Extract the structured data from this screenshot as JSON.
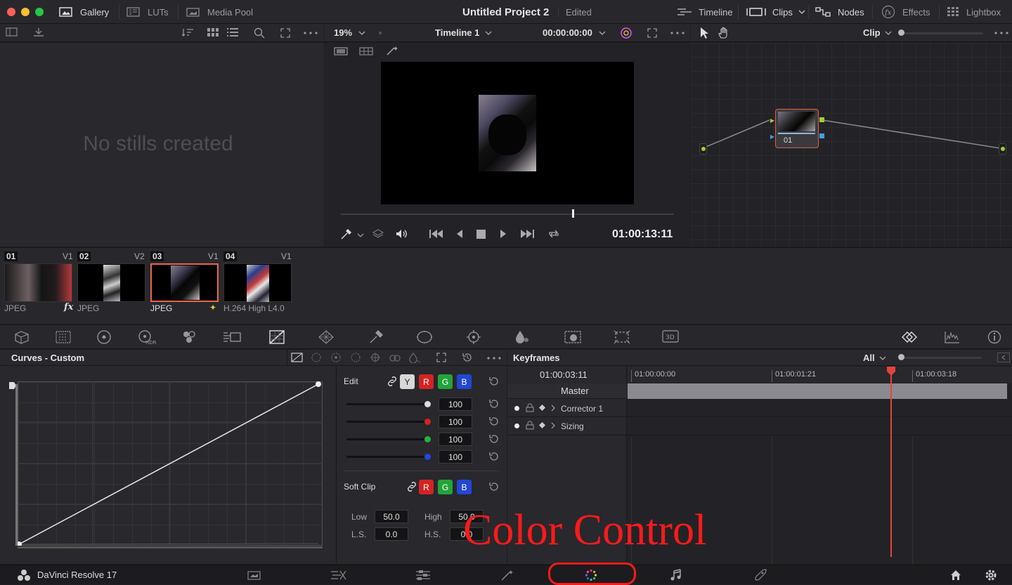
{
  "app": {
    "name": "DaVinci Resolve 17"
  },
  "project": {
    "title": "Untitled Project 2",
    "status": "Edited"
  },
  "topbar": {
    "gallery": "Gallery",
    "luts": "LUTs",
    "media_pool": "Media Pool",
    "timeline": "Timeline",
    "clips": "Clips",
    "nodes": "Nodes",
    "effects": "Effects",
    "lightbox": "Lightbox"
  },
  "viewer": {
    "zoom": "19%",
    "timeline_name": "Timeline 1",
    "timecode_top": "00:00:00:00",
    "timecode": "01:00:13:11"
  },
  "gallery": {
    "empty_text": "No stills created"
  },
  "nodes": {
    "mode": "Clip",
    "node_label": "01"
  },
  "clips": [
    {
      "num": "01",
      "track": "V1",
      "codec": "JPEG",
      "badge": "fx"
    },
    {
      "num": "02",
      "track": "V2",
      "codec": "JPEG",
      "badge": ""
    },
    {
      "num": "03",
      "track": "V1",
      "codec": "JPEG",
      "badge": "✦"
    },
    {
      "num": "04",
      "track": "V1",
      "codec": "H.264 High L4.0",
      "badge": ""
    }
  ],
  "curves": {
    "title": "Curves - Custom",
    "edit_label": "Edit",
    "channels": [
      "Y",
      "R",
      "G",
      "B"
    ],
    "values": [
      "100",
      "100",
      "100",
      "100"
    ],
    "soft_clip_label": "Soft Clip",
    "soft_channels": [
      "R",
      "G",
      "B"
    ],
    "low_label": "Low",
    "low": "50.0",
    "high_label": "High",
    "high": "50.0",
    "ls_label": "L.S.",
    "ls": "0.0",
    "hs_label": "H.S.",
    "hs": "0.0"
  },
  "keyframes": {
    "title": "Keyframes",
    "filter": "All",
    "current_tc": "01:00:03:11",
    "ruler": [
      "01:00:00:00",
      "01:00:01:21",
      "01:00:03:18"
    ],
    "master": "Master",
    "tracks": [
      "Corrector 1",
      "Sizing"
    ]
  },
  "annotation": {
    "text": "Color Control",
    "color": "#ff1a1a"
  },
  "colors": {
    "accent_red": "#e8664d",
    "playhead": "#e5443a",
    "node_green": "#9ccf3c",
    "node_blue": "#3aa0e6"
  }
}
